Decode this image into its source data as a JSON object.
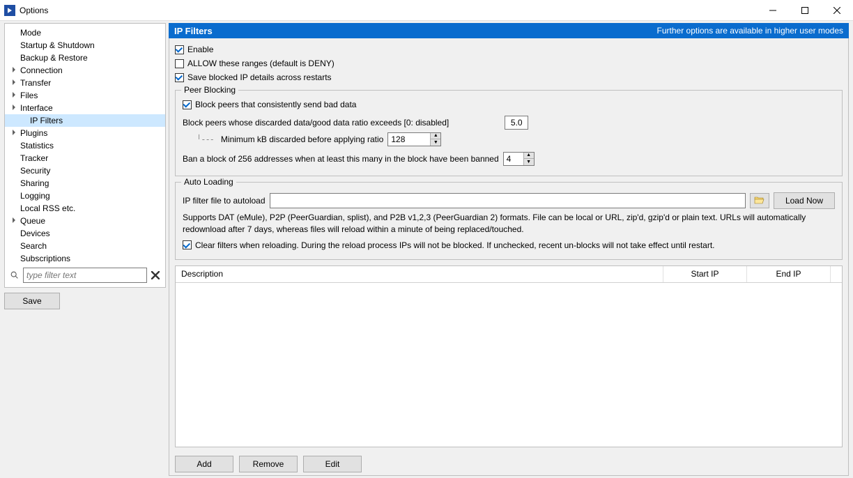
{
  "window": {
    "title": "Options"
  },
  "sidebar": {
    "items": [
      {
        "label": "Mode",
        "expandable": false,
        "level": 1
      },
      {
        "label": "Startup & Shutdown",
        "expandable": false,
        "level": 1
      },
      {
        "label": "Backup & Restore",
        "expandable": false,
        "level": 1
      },
      {
        "label": "Connection",
        "expandable": true,
        "level": 1
      },
      {
        "label": "Transfer",
        "expandable": true,
        "level": 1
      },
      {
        "label": "Files",
        "expandable": true,
        "level": 1
      },
      {
        "label": "Interface",
        "expandable": true,
        "level": 1
      },
      {
        "label": "IP Filters",
        "expandable": false,
        "level": 2,
        "selected": true
      },
      {
        "label": "Plugins",
        "expandable": true,
        "level": 1
      },
      {
        "label": "Statistics",
        "expandable": false,
        "level": 1
      },
      {
        "label": "Tracker",
        "expandable": false,
        "level": 1
      },
      {
        "label": "Security",
        "expandable": false,
        "level": 1
      },
      {
        "label": "Sharing",
        "expandable": false,
        "level": 1
      },
      {
        "label": "Logging",
        "expandable": false,
        "level": 1
      },
      {
        "label": "Local RSS etc.",
        "expandable": false,
        "level": 1
      },
      {
        "label": "Queue",
        "expandable": true,
        "level": 1
      },
      {
        "label": "Devices",
        "expandable": false,
        "level": 1
      },
      {
        "label": "Search",
        "expandable": false,
        "level": 1
      },
      {
        "label": "Subscriptions",
        "expandable": false,
        "level": 1
      }
    ],
    "filter_placeholder": "type filter text",
    "save_label": "Save"
  },
  "panel": {
    "title": "IP Filters",
    "header_note": "Further options are available in higher user modes",
    "enable_label": "Enable",
    "enable_checked": true,
    "allow_label": "ALLOW these ranges (default is DENY)",
    "allow_checked": false,
    "save_blocked_label": "Save blocked IP details across restarts",
    "save_blocked_checked": true,
    "peer_blocking": {
      "group_title": "Peer Blocking",
      "block_bad_label": "Block peers that consistently send bad data",
      "block_bad_checked": true,
      "ratio_label": "Block peers whose discarded data/good data ratio exceeds [0: disabled]",
      "ratio_value": "5.0",
      "min_kb_label": "Minimum kB discarded before applying ratio",
      "min_kb_value": "128",
      "ban_block_label": "Ban a block of 256 addresses when at least this many in the block have been banned",
      "ban_block_value": "4"
    },
    "auto_loading": {
      "group_title": "Auto Loading",
      "file_label": "IP filter file to autoload",
      "file_value": "",
      "load_now_label": "Load Now",
      "note": "Supports DAT (eMule), P2P (PeerGuardian, splist), and P2B v1,2,3 (PeerGuardian 2) formats.  File can be local or URL, zip'd, gzip'd or plain text.  URLs will automatically redownload after 7 days, whereas files will reload within a minute of being replaced/touched.",
      "clear_label": "Clear filters when reloading. During the reload process IPs will not be blocked. If unchecked, recent un-blocks will not take effect until restart.",
      "clear_checked": true
    },
    "table": {
      "col_desc": "Description",
      "col_start": "Start IP",
      "col_end": "End IP"
    },
    "buttons": {
      "add": "Add",
      "remove": "Remove",
      "edit": "Edit"
    }
  }
}
